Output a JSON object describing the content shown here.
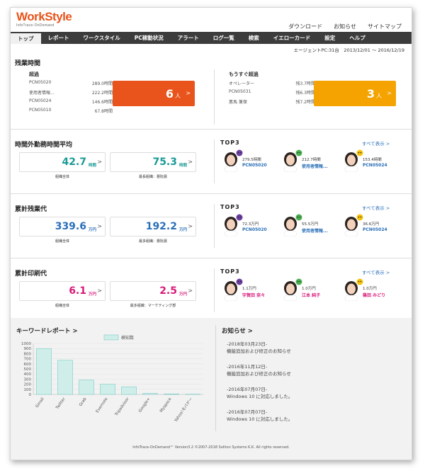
{
  "header": {
    "logo": "WorkStyle",
    "logo_sub": "InfoTrace-OnDemand",
    "links": [
      "ダウンロード",
      "お知らせ",
      "サイトマップ"
    ]
  },
  "nav": [
    "トップ",
    "レポート",
    "ワークスタイル",
    "PC稼動状況",
    "アラート",
    "ログ一覧",
    "検索",
    "イエローカード",
    "設定",
    "ヘルプ"
  ],
  "agent_line": "エージェントPC:31台　2013/12/01 ～ 2016/12/19",
  "overtime": {
    "title": "残業時間",
    "over_label": "超過",
    "over_rows": [
      {
        "name": "PCN05020",
        "value": "289.0時間"
      },
      {
        "name": "使用者情報...",
        "value": "222.2時間"
      },
      {
        "name": "PCN05024",
        "value": "146.6時間"
      },
      {
        "name": "PCN05010",
        "value": "67.8時間"
      }
    ],
    "over_count": "6",
    "unit": "人",
    "near_label": "もうすぐ超過",
    "near_rows": [
      {
        "name": "オペレーター",
        "value": "残3.7時間"
      },
      {
        "name": "PCN05031",
        "value": "残6.3時間"
      },
      {
        "name": "悪馬 兼保",
        "value": "残7.2時間"
      }
    ],
    "near_count": "3"
  },
  "sections": [
    {
      "title": "時間外勤務時間平均",
      "color": "#1a9a96",
      "card1": {
        "value": "42.7",
        "unit": "時間",
        "caption": "組織全体"
      },
      "card2": {
        "value": "75.3",
        "unit": "時間",
        "caption": "最長組織：悪阮晨"
      },
      "top_label": "TOP3",
      "see_all": "すべて表示 >",
      "people": [
        {
          "hours": "279.5時間",
          "name": "PCN05020",
          "badge": "#6b3fa0"
        },
        {
          "hours": "212.7時間",
          "name": "使用者情報...",
          "badge": "#4caf50"
        },
        {
          "hours": "153.4時間",
          "name": "PCN05024",
          "badge": "#f4c20d"
        }
      ]
    },
    {
      "title": "累計残業代",
      "color": "#2a6fb8",
      "card1": {
        "value": "339.6",
        "unit": "万円",
        "caption": "組織全体"
      },
      "card2": {
        "value": "192.2",
        "unit": "万円",
        "caption": "最多組織：悪阮晨"
      },
      "top_label": "TOP3",
      "see_all": "すべて表示 >",
      "people": [
        {
          "hours": "72.3万円",
          "name": "PCN05020",
          "badge": "#6b3fa0"
        },
        {
          "hours": "55.5万円",
          "name": "使用者情報...",
          "badge": "#4caf50"
        },
        {
          "hours": "36.6万円",
          "name": "PCN05024",
          "badge": "#f4c20d"
        }
      ]
    },
    {
      "title": "累計印刷代",
      "color": "#d81b7a",
      "card1": {
        "value": "6.1",
        "unit": "万円",
        "caption": "組織全体"
      },
      "card2": {
        "value": "2.5",
        "unit": "万円",
        "caption": "最多組織：マーケティング部"
      },
      "top_label": "TOP3",
      "see_all": "すべて表示 >",
      "people": [
        {
          "hours": "1.1万円",
          "name": "宇賀田 奈々",
          "badge": "#6b3fa0"
        },
        {
          "hours": "1.0万円",
          "name": "江本 純子",
          "badge": "#4caf50"
        },
        {
          "hours": "1.0万円",
          "name": "篠田 みどり",
          "badge": "#f4c20d"
        }
      ]
    }
  ],
  "keyword": {
    "title": "キーワードレポート >"
  },
  "chart_data": {
    "type": "bar",
    "categories": [
      "Gmail",
      "Twitter",
      "Grab",
      "Evernote",
      "Tripadvisor",
      "Google+",
      "Myspace",
      "Yahoo!モバゲー"
    ],
    "series": [
      {
        "name": "検知数",
        "values": [
          900,
          670,
          280,
          200,
          150,
          20,
          10,
          5
        ]
      }
    ],
    "ylim": [
      0,
      1000
    ],
    "yticks": [
      0,
      100,
      200,
      300,
      400,
      500,
      600,
      700,
      800,
      900,
      1000
    ],
    "legend": "top",
    "grid": true,
    "bar_color": "#cfeeea",
    "bar_border": "#7bcbc4"
  },
  "news": {
    "title": "お知らせ >",
    "items": [
      {
        "date": "-2018年03月23日-",
        "text": "機能追加および修正のお知らせ"
      },
      {
        "date": "-2016年11月12日-",
        "text": "機能追加および修正のお知らせ"
      },
      {
        "date": "-2016年07月07日-",
        "text": "Windows 10 に対応しました。"
      },
      {
        "date": "-2016年07月07日-",
        "text": "Windows 10 に対応しました。"
      }
    ]
  },
  "footer": "InfoTrace-OnDemand™ Version3.2 ©2007-2018 Soliton Systems K.K. All rights reserved.",
  "colors": {
    "orange": "#e8541b",
    "amber": "#f5a300",
    "nav": "#3c3c3c"
  }
}
